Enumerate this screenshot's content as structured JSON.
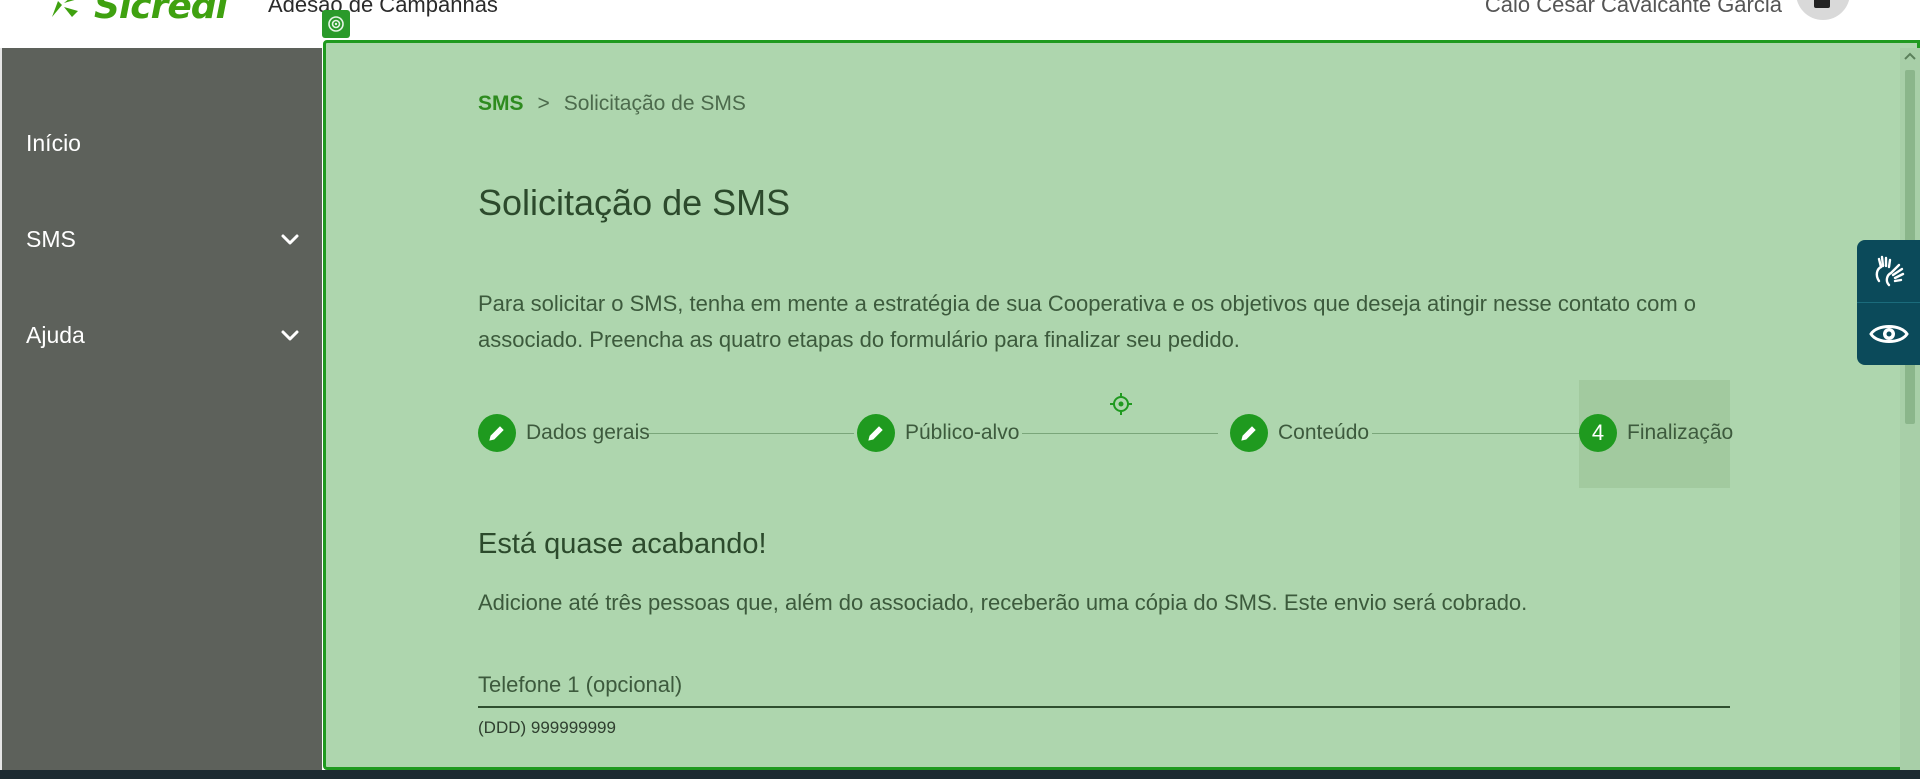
{
  "header": {
    "logo_text": "Sicredi",
    "app_title": "Adesão de Campanhas",
    "user_name": "Caio César Cavalcante Garcia"
  },
  "sidebar": {
    "items": [
      {
        "label": "Início",
        "has_chevron": false
      },
      {
        "label": "SMS",
        "has_chevron": true
      },
      {
        "label": "Ajuda",
        "has_chevron": true
      }
    ]
  },
  "breadcrumb": {
    "parent": "SMS",
    "separator": ">",
    "current": "Solicitação de SMS"
  },
  "page": {
    "title": "Solicitação de SMS",
    "intro": "Para solicitar o SMS, tenha em mente a estratégia de sua Cooperativa e os objetivos que deseja atingir nesse contato com o associado. Preencha as quatro etapas do formulário para finalizar seu pedido."
  },
  "stepper": {
    "steps": [
      {
        "label": "Dados gerais",
        "status": "completed",
        "icon": "pencil-icon"
      },
      {
        "label": "Público-alvo",
        "status": "completed",
        "icon": "pencil-icon"
      },
      {
        "label": "Conteúdo",
        "status": "completed",
        "icon": "pencil-icon"
      },
      {
        "label": "Finalização",
        "status": "active",
        "number": "4"
      }
    ]
  },
  "section": {
    "title": "Está quase acabando!",
    "description": "Adicione até três pessoas que, além do associado, receberão uma cópia do SMS. Este envio será cobrado."
  },
  "form": {
    "phone1_label": "Telefone 1 (opcional)",
    "phone1_hint": "(DDD) 999999999"
  },
  "accessibility": {
    "sign_language_icon": "sign-language-icon",
    "visibility_icon": "eye-icon"
  },
  "colors": {
    "brand_green": "#3fa110",
    "sidebar_bg": "#5d615b",
    "overlay_green": "#aed6ae",
    "overlay_border": "#1f9a1f",
    "a11y_bg": "#0b4a5a"
  }
}
